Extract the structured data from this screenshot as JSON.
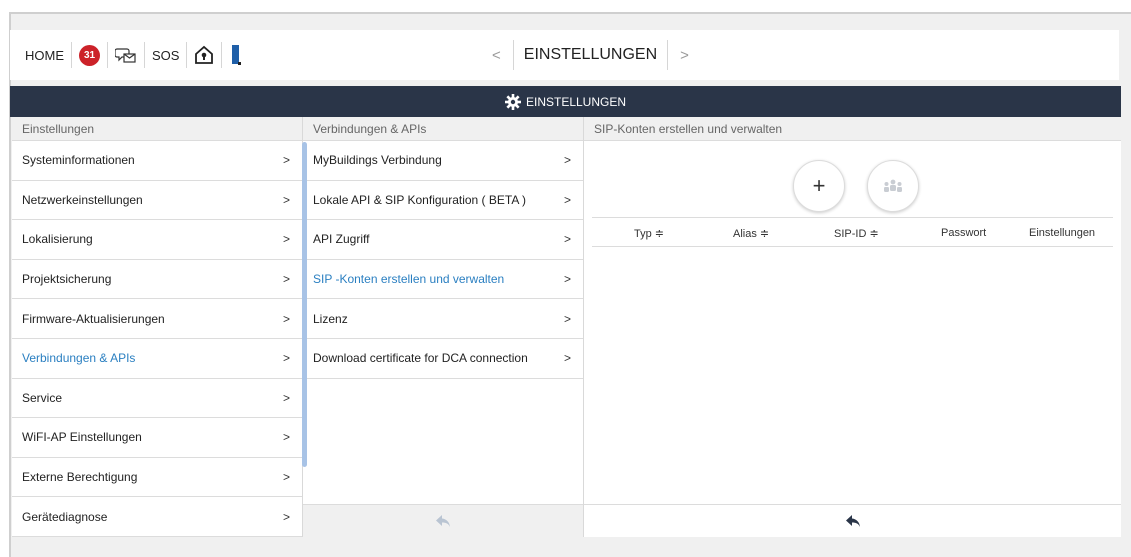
{
  "topbar": {
    "home_label": "HOME",
    "badge_count": "31",
    "sos_label": "SOS",
    "title": "EINSTELLUNGEN",
    "prev_arrow": "<",
    "next_arrow": ">"
  },
  "header": {
    "title": "EINSTELLUNGEN",
    "icon": "gear-icon"
  },
  "col1": {
    "heading": "Einstellungen",
    "items": [
      {
        "label": "Systeminformationen"
      },
      {
        "label": "Netzwerkeinstellungen"
      },
      {
        "label": "Lokalisierung"
      },
      {
        "label": "Projektsicherung"
      },
      {
        "label": "Firmware-Aktualisierungen"
      },
      {
        "label": "Verbindungen & APIs",
        "active": true
      },
      {
        "label": "Service"
      },
      {
        "label": "WiFI-AP Einstellungen"
      },
      {
        "label": "Externe Berechtigung"
      },
      {
        "label": "Gerätediagnose"
      }
    ]
  },
  "col2": {
    "heading": "Verbindungen & APIs",
    "items": [
      {
        "label": "MyBuildings Verbindung"
      },
      {
        "label": "Lokale API & SIP Konfiguration ( BETA )"
      },
      {
        "label": "API Zugriff"
      },
      {
        "label": "SIP -Konten erstellen und verwalten",
        "active": true
      },
      {
        "label": "Lizenz"
      },
      {
        "label": "Download certificate for DCA connection"
      }
    ]
  },
  "col3": {
    "heading": "SIP-Konten erstellen und verwalten",
    "add_label": "+",
    "table_headers": [
      "Typ ≑",
      "Alias ≑",
      "SIP-ID ≑",
      "Passwort",
      "Einstellungen"
    ]
  },
  "colors": {
    "accent": "#2a7fc1",
    "header_bg": "#2a3548",
    "badge": "#cc2229"
  }
}
